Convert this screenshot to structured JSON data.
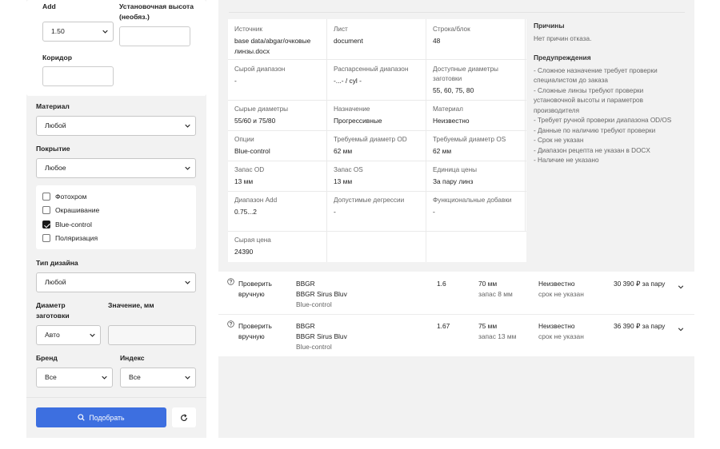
{
  "sidebar": {
    "add_label": "Add",
    "mount_height_label": "Установочная высота (необяз.)",
    "add_value": "1.50",
    "mount_height_value": "",
    "corridor_label": "Коридор",
    "corridor_value": "",
    "material_label": "Материал",
    "material_value": "Любой",
    "coating_label": "Покрытие",
    "coating_value": "Любое",
    "checkboxes": [
      {
        "label": "Фотохром",
        "checked": false
      },
      {
        "label": "Окрашивание",
        "checked": false
      },
      {
        "label": "Blue-control",
        "checked": true
      },
      {
        "label": "Поляризация",
        "checked": false
      }
    ],
    "design_label": "Тип дизайна",
    "design_value": "Любой",
    "blank_diam_label": "Диаметр заготовки",
    "value_mm_label": "Значение, мм",
    "blank_diam_value": "Авто",
    "value_mm_value": "",
    "brand_label": "Бренд",
    "index_label": "Индекс",
    "brand_value": "Все",
    "index_value": "Все",
    "submit_label": "Подобрать",
    "reset_icon": "refresh-icon"
  },
  "details": {
    "cells": [
      {
        "key": "Источник",
        "value": "base data/abgar/очковые линзы.docx"
      },
      {
        "key": "Лист",
        "value": "document"
      },
      {
        "key": "Строка/блок",
        "value": "48"
      },
      {
        "key": "Сырой диапазон",
        "value": "-"
      },
      {
        "key": "Распарсенный диапазон",
        "value": "-...- / cyl -"
      },
      {
        "key": "Доступные диаметры заготовки",
        "value": "55, 60, 75, 80"
      },
      {
        "key": "Сырые диаметры",
        "value": "55/60 и 75/80"
      },
      {
        "key": "Назначение",
        "value": "Прогрессивные"
      },
      {
        "key": "Материал",
        "value": "Неизвестно"
      },
      {
        "key": "Опции",
        "value": "Blue-control"
      },
      {
        "key": "Требуемый диаметр OD",
        "value": "62 мм"
      },
      {
        "key": "Требуемый диаметр OS",
        "value": "62 мм"
      },
      {
        "key": "Запас OD",
        "value": "13 мм"
      },
      {
        "key": "Запас OS",
        "value": "13 мм"
      },
      {
        "key": "Единица цены",
        "value": "За пару линз"
      },
      {
        "key": "Диапазон Add",
        "value": "0.75...2"
      },
      {
        "key": "Допустимые дегрессии",
        "value": "-"
      },
      {
        "key": "Функциональные добавки",
        "value": "-"
      },
      {
        "key": "Сырая цена",
        "value": "24390"
      }
    ],
    "reasons_title": "Причины",
    "reasons_text": "Нет причин отказа.",
    "warnings_title": "Предупреждения",
    "warnings": [
      "- Сложное назначение требует проверки специалистом до заказа",
      "- Сложные линзы требуют проверки установочной высоты и параметров производителя",
      "- Требует ручной проверки диапазона OD/OS",
      "- Данные по наличию требуют проверки",
      "- Срок не указан",
      "- Диапазон рецепта не указан в DOCX",
      "- Наличие не указано"
    ]
  },
  "results": [
    {
      "status": "Проверить вручную",
      "brand": "BBGR",
      "product": "BBGR Sirus Bluv",
      "option": "Blue-control",
      "index": "1.6",
      "diameter": "70 мм",
      "reserve": "запас 8 мм",
      "availability": "Неизвестно",
      "term": "срок не указан",
      "price": "30 390 ₽ за пару"
    },
    {
      "status": "Проверить вручную",
      "brand": "BBGR",
      "product": "BBGR Sirus Bluv",
      "option": "Blue-control",
      "index": "1.67",
      "diameter": "75 мм",
      "reserve": "запас 13 мм",
      "availability": "Неизвестно",
      "term": "срок не указан",
      "price": "36 390 ₽ за пару"
    }
  ]
}
